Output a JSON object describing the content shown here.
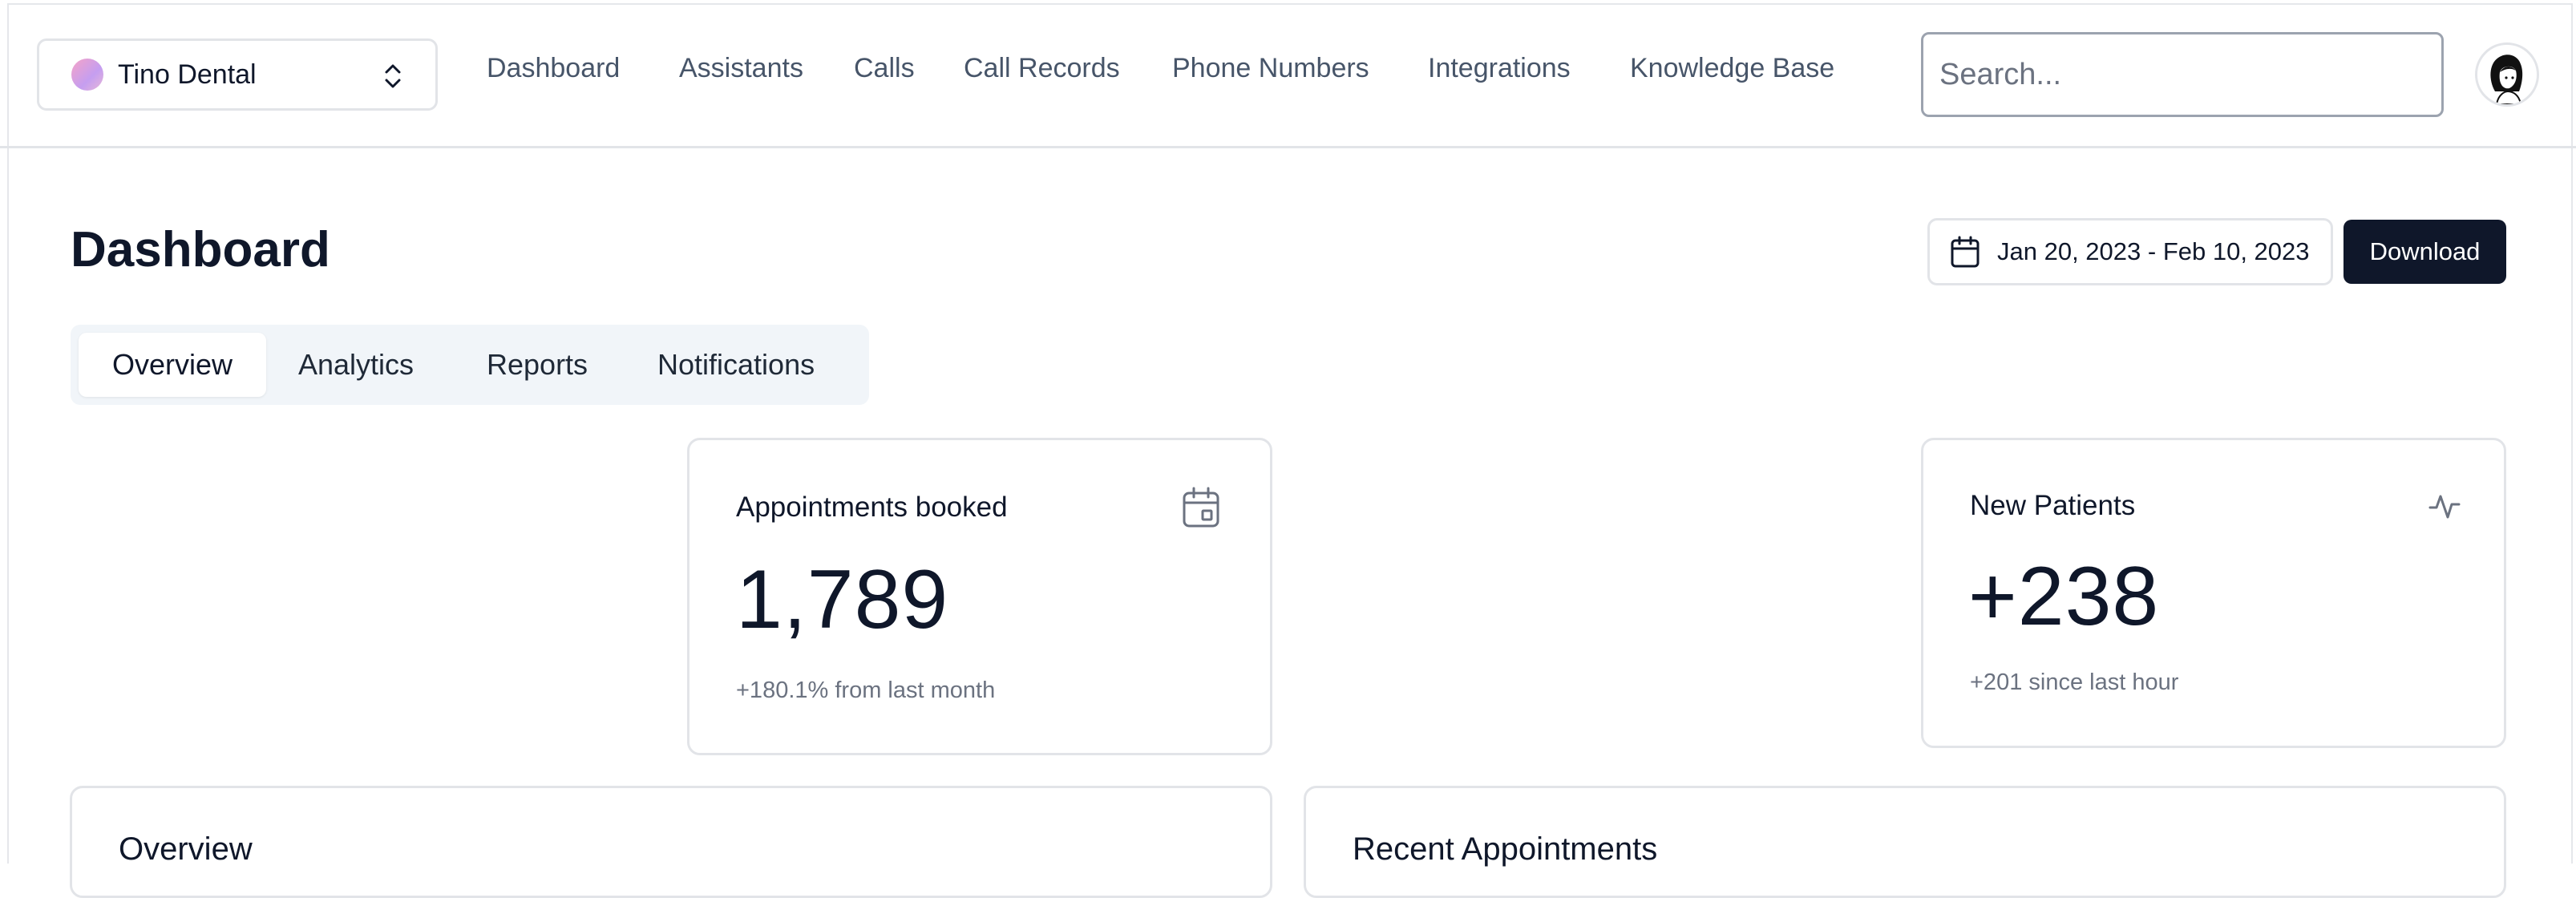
{
  "org_switcher": {
    "name": "Tino Dental"
  },
  "nav": {
    "items": [
      {
        "label": "Dashboard"
      },
      {
        "label": "Assistants"
      },
      {
        "label": "Calls"
      },
      {
        "label": "Call Records"
      },
      {
        "label": "Phone Numbers"
      },
      {
        "label": "Integrations"
      },
      {
        "label": "Knowledge Base"
      }
    ]
  },
  "search": {
    "placeholder": "Search..."
  },
  "page": {
    "title": "Dashboard",
    "date_range": "Jan 20, 2023 - Feb 10, 2023",
    "download_label": "Download"
  },
  "tabs": [
    {
      "label": "Overview",
      "active": true
    },
    {
      "label": "Analytics"
    },
    {
      "label": "Reports"
    },
    {
      "label": "Notifications"
    }
  ],
  "stats": {
    "appointments": {
      "title": "Appointments booked",
      "value": "1,789",
      "sub": "+180.1% from last month",
      "icon": "calendar-icon"
    },
    "new_patients": {
      "title": "New Patients",
      "value": "+238",
      "sub": "+201 since last hour",
      "icon": "activity-icon"
    }
  },
  "panels": {
    "overview_title": "Overview",
    "recent_title": "Recent Appointments"
  }
}
